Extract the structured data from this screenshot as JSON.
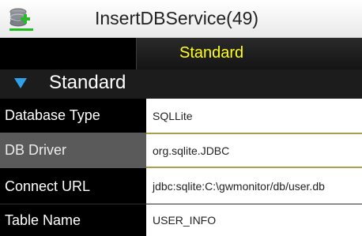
{
  "header": {
    "title": "InsertDBService(49)",
    "app_icon": "database-add-icon"
  },
  "subheader": {
    "label": "Standard",
    "label_color": "#ffff1a"
  },
  "section": {
    "label": "Standard",
    "expand_icon": "triangle-down-icon",
    "icon_color": "#30a0e8"
  },
  "fields": [
    {
      "label": "Database Type",
      "value": "SQLLite"
    },
    {
      "label": "DB Driver",
      "value": "org.sqlite.JDBC"
    },
    {
      "label": "Connect URL",
      "value": "jdbc:sqlite:C:\\gwmonitor/db/user.db"
    },
    {
      "label": "Table Name",
      "value": "USER_INFO"
    }
  ]
}
